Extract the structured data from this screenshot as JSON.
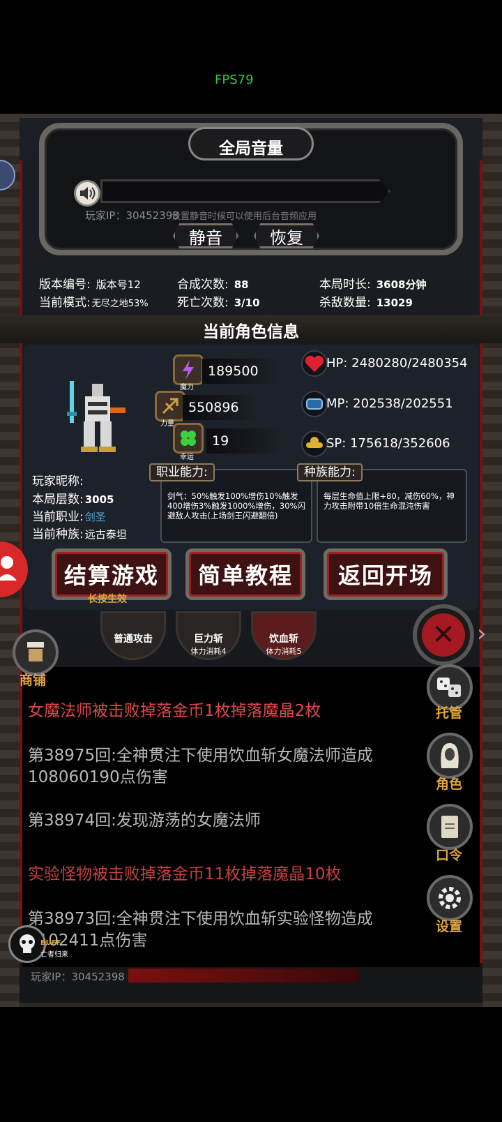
{
  "fps": "FPS79",
  "volume": {
    "title": "全局音量",
    "player_ip": "玩家IP：30452398",
    "hint": "设置静音时候可以使用后台音频应用",
    "mute_label": "静音",
    "restore_label": "恢复"
  },
  "stats": {
    "version_label": "版本编号:",
    "version_value": "版本号12",
    "mode_label": "当前模式:",
    "mode_value": "无尽之地53%",
    "craft_label": "合成次数:",
    "craft_value": "88",
    "death_label": "死亡次数:",
    "death_value": "3/10",
    "duration_label": "本局时长:",
    "duration_value": "3608分钟",
    "kills_label": "杀敌数量:",
    "kills_value": "13029"
  },
  "character": {
    "section_title": "当前角色信息",
    "magic_value": "189500",
    "magic_caption": "魔力",
    "power_value": "550896",
    "power_caption": "力量",
    "luck_value": "19",
    "luck_caption": "幸运",
    "hp": "HP:  2480280/2480354",
    "mp": "MP:  202538/202551",
    "sp": "SP:  175618/352606",
    "nickname_label": "玩家昵称:",
    "floors_label": "本局层数:",
    "floors_value": "3005",
    "class_label": "当前职业:",
    "class_value": "剑圣",
    "race_label": "当前种族:",
    "race_value": "远古泰坦",
    "class_ability_tag": "职业能力:",
    "class_ability_text": "剑气：50%触发100%增伤10%触发400增伤3%触发1000%增伤，30%闪避敌人攻击(上场剑王闪避翻倍)",
    "race_ability_tag": "种族能力:",
    "race_ability_text": "每层生命值上限+80，减伤60%，神力攻击附带10倍生命混沌伤害"
  },
  "buttons": {
    "settle": "结算游戏",
    "settle_note": "长按生效",
    "tutorial": "简单教程",
    "return": "返回开场"
  },
  "skills": [
    {
      "name": "普通攻击",
      "cost": ""
    },
    {
      "name": "巨力斩",
      "cost": "体力消耗4"
    },
    {
      "name": "饮血斩",
      "cost": "体力消耗5"
    }
  ],
  "side": {
    "shop": "商铺",
    "auto": "托管",
    "role": "角色",
    "code": "口令",
    "settings": "设置"
  },
  "log": [
    "女魔法师被击败掉落金币1枚掉落魔晶2枚",
    "第38975回:全神贯注下使用饮血斩女魔法师造成108060190点伤害",
    "第38974回:发现游荡的女魔法师",
    "实验怪物被击败掉落金币11枚掉落魔晶10枚",
    "第38973回:全神贯注下使用饮血斩实验怪物造成1102411点伤害"
  ],
  "buff": {
    "tag": "BUFF",
    "name": "亡者归来"
  },
  "footer_ip": "玩家IP：30452398",
  "colors": {
    "accent_gold": "#e0a63c",
    "danger_red": "#d8282a",
    "fps_green": "#2ecc40"
  }
}
